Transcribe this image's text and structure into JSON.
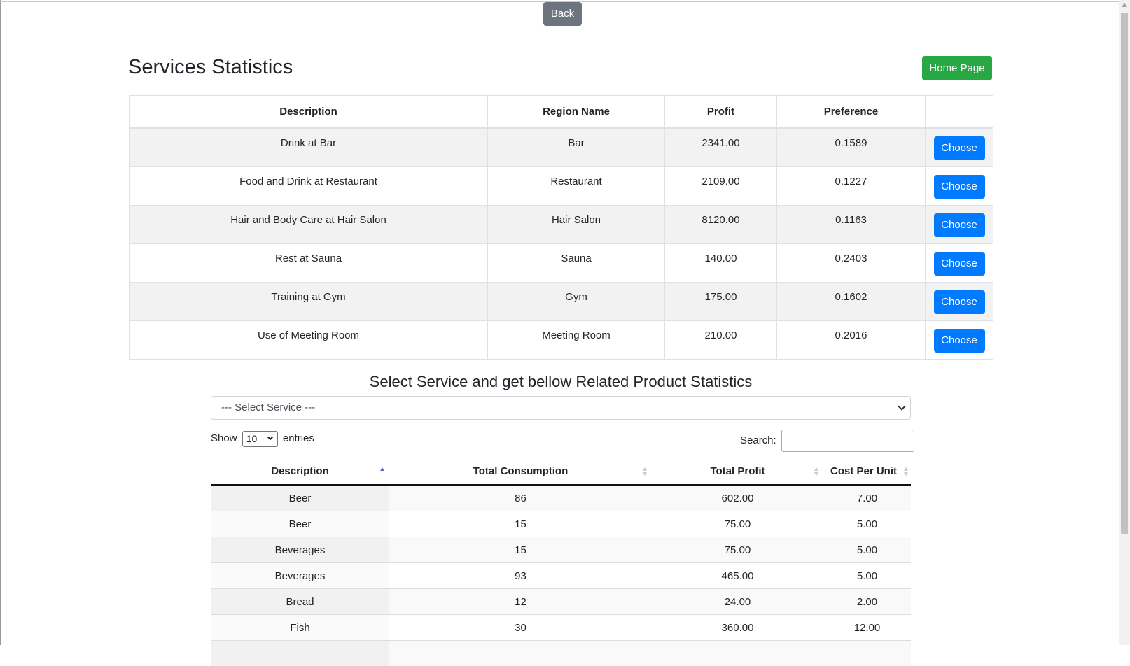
{
  "header": {
    "back_label": "Back",
    "title": "Services Statistics",
    "home_label": "Home Page"
  },
  "services": {
    "columns": [
      "Description",
      "Region Name",
      "Profit",
      "Preference",
      ""
    ],
    "choose_label": "Choose",
    "rows": [
      {
        "description": "Drink at Bar",
        "region": "Bar",
        "profit": "2341.00",
        "preference": "0.1589"
      },
      {
        "description": "Food and Drink at Restaurant",
        "region": "Restaurant",
        "profit": "2109.00",
        "preference": "0.1227"
      },
      {
        "description": "Hair and Body Care at Hair Salon",
        "region": "Hair Salon",
        "profit": "8120.00",
        "preference": "0.1163"
      },
      {
        "description": "Rest at Sauna",
        "region": "Sauna",
        "profit": "140.00",
        "preference": "0.2403"
      },
      {
        "description": "Training at Gym",
        "region": "Gym",
        "profit": "175.00",
        "preference": "0.1602"
      },
      {
        "description": "Use of Meeting Room",
        "region": "Meeting Room",
        "profit": "210.00",
        "preference": "0.2016"
      }
    ]
  },
  "products": {
    "subtitle": "Select Service and get bellow Related Product Statistics",
    "select_value": "--- Select Service ---",
    "show_label": "Show",
    "entries_value": "10",
    "entries_label": "entries",
    "search_label": "Search:",
    "search_value": "",
    "columns": [
      "Description",
      "Total Consumption",
      "Total Profit",
      "Cost Per Unit"
    ],
    "sorted_column": "Description",
    "sort_direction": "ascending",
    "rows": [
      {
        "description": "Beer",
        "consumption": "86",
        "profit": "602.00",
        "cost": "7.00"
      },
      {
        "description": "Beer",
        "consumption": "15",
        "profit": "75.00",
        "cost": "5.00"
      },
      {
        "description": "Beverages",
        "consumption": "15",
        "profit": "75.00",
        "cost": "5.00"
      },
      {
        "description": "Beverages",
        "consumption": "93",
        "profit": "465.00",
        "cost": "5.00"
      },
      {
        "description": "Bread",
        "consumption": "12",
        "profit": "24.00",
        "cost": "2.00"
      },
      {
        "description": "Fish",
        "consumption": "30",
        "profit": "360.00",
        "cost": "12.00"
      },
      {
        "description": "",
        "consumption": "",
        "profit": "",
        "cost": ""
      }
    ]
  }
}
